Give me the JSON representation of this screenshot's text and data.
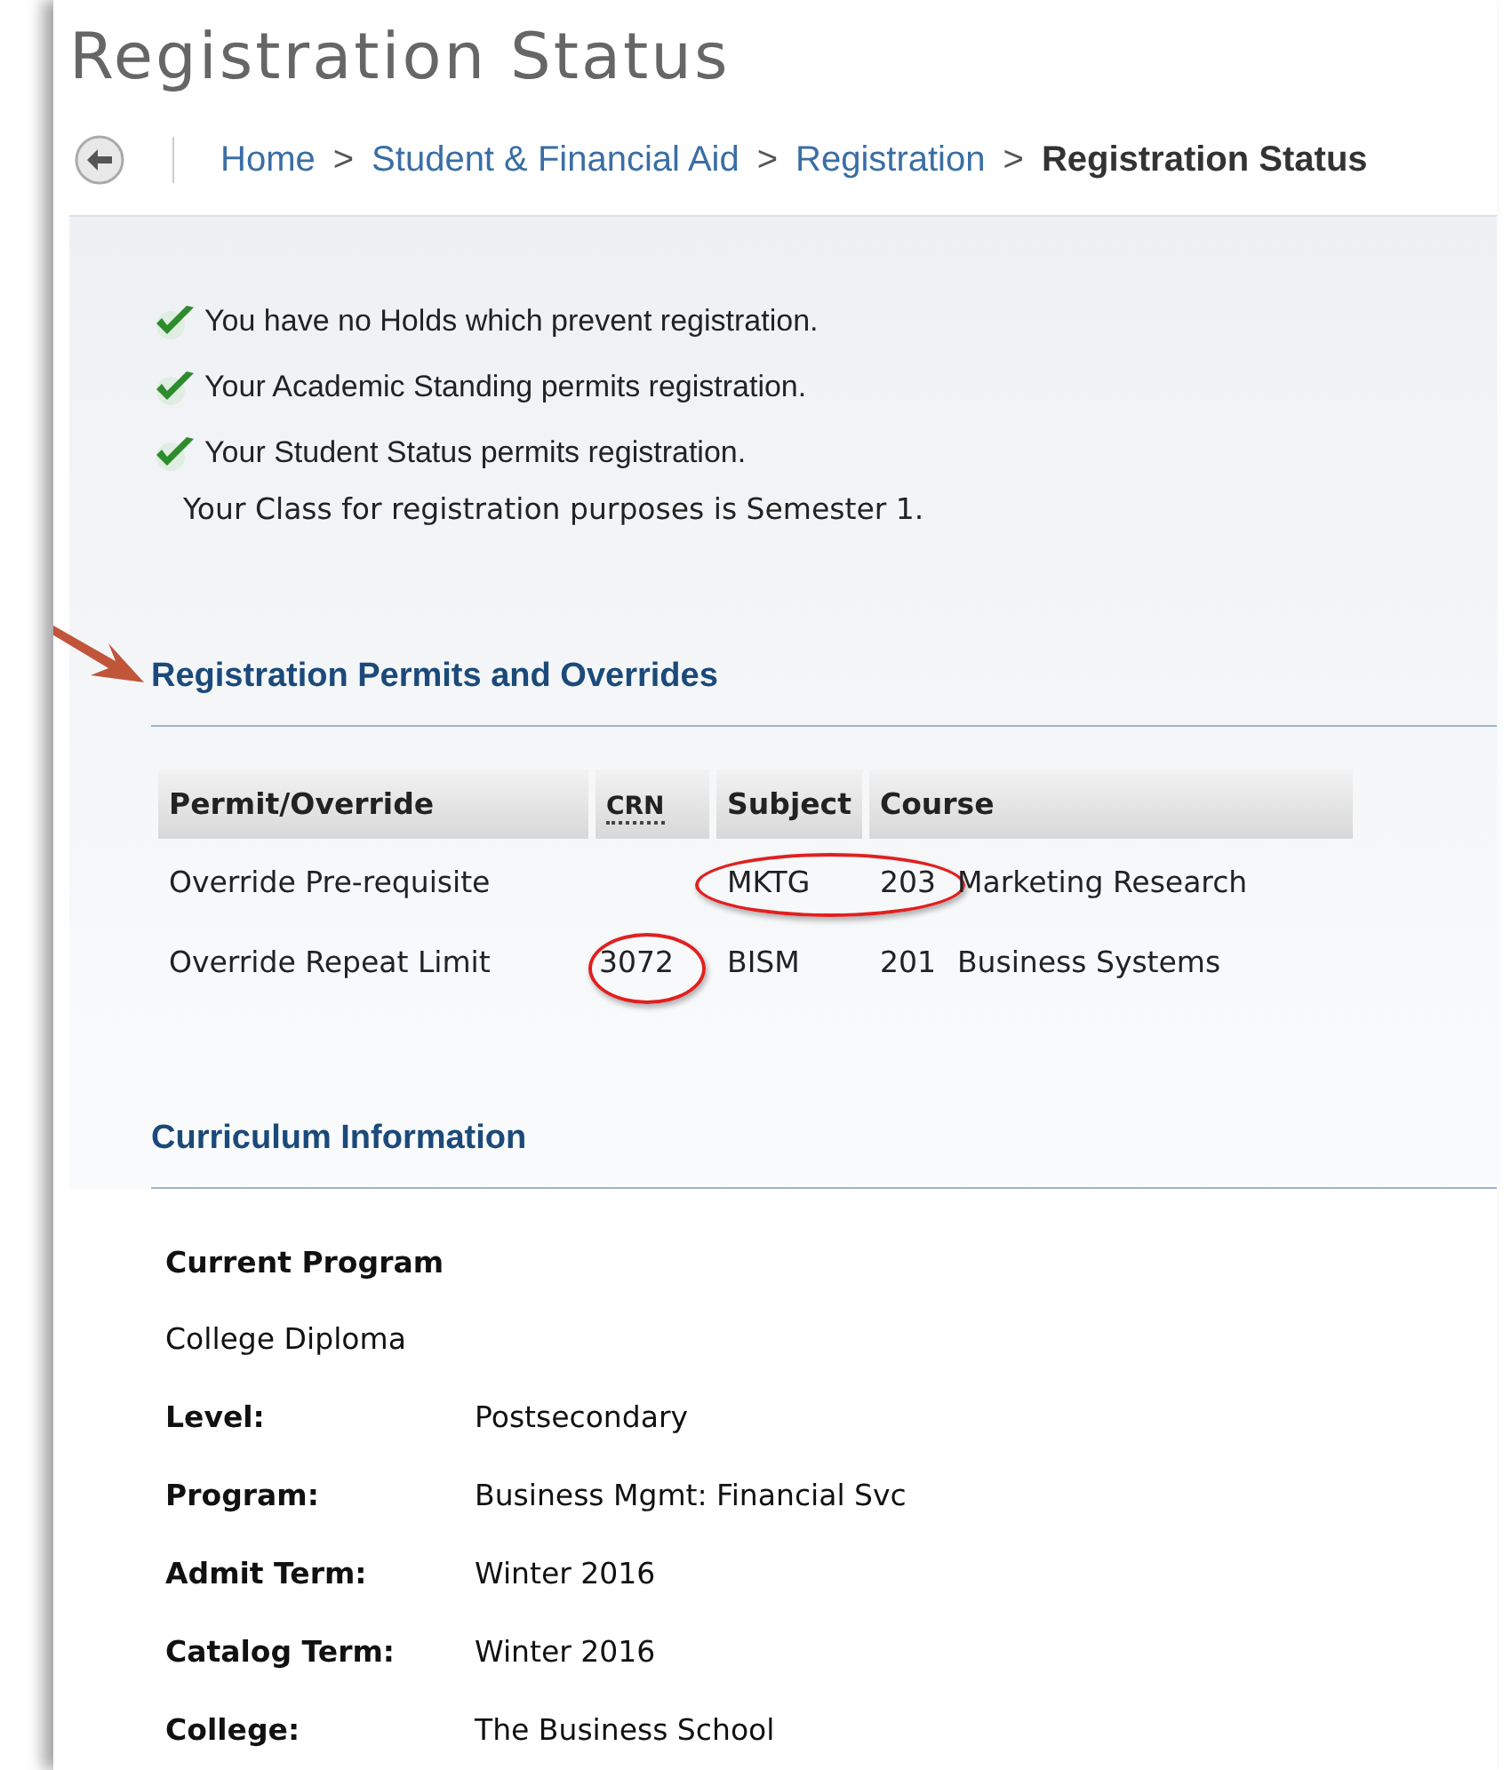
{
  "page": {
    "title": "Registration Status"
  },
  "breadcrumb": [
    {
      "label": "Home",
      "current": false
    },
    {
      "label": "Student & Financial Aid",
      "current": false
    },
    {
      "label": "Registration",
      "current": false
    },
    {
      "label": "Registration Status",
      "current": true
    }
  ],
  "breadcrumb_separator": ">",
  "status_checks": [
    {
      "text": "You have no Holds which prevent registration.",
      "ok": true
    },
    {
      "text": "Your Academic Standing permits registration.",
      "ok": true
    },
    {
      "text": "Your Student Status permits registration.",
      "ok": true
    }
  ],
  "class_note": "Your Class for registration purposes is Semester 1.",
  "permits": {
    "heading": "Registration Permits and Overrides",
    "arrow_pointer": true,
    "columns": [
      "Permit/Override",
      "CRN",
      "Subject",
      "Course"
    ],
    "rows": [
      {
        "permit": "Override Pre-requisite",
        "crn": "",
        "subject": "MKTG",
        "course_number": "203",
        "course_title": "Marketing Research",
        "crn_circled": false,
        "subject_course_circled": true
      },
      {
        "permit": "Override Repeat Limit",
        "crn": "3072",
        "subject": "BISM",
        "course_number": "201",
        "course_title": "Business Systems",
        "crn_circled": true,
        "subject_course_circled": false
      }
    ]
  },
  "curriculum": {
    "heading": "Curriculum Information",
    "program_heading": "Current Program",
    "program_name": "College Diploma",
    "fields": [
      {
        "label": "Level:",
        "value": "Postsecondary"
      },
      {
        "label": "Program:",
        "value": "Business Mgmt: Financial Svc"
      },
      {
        "label": "Admit Term:",
        "value": "Winter 2016"
      },
      {
        "label": "Catalog Term:",
        "value": "Winter 2016"
      },
      {
        "label": "College:",
        "value": "The Business School"
      }
    ]
  }
}
